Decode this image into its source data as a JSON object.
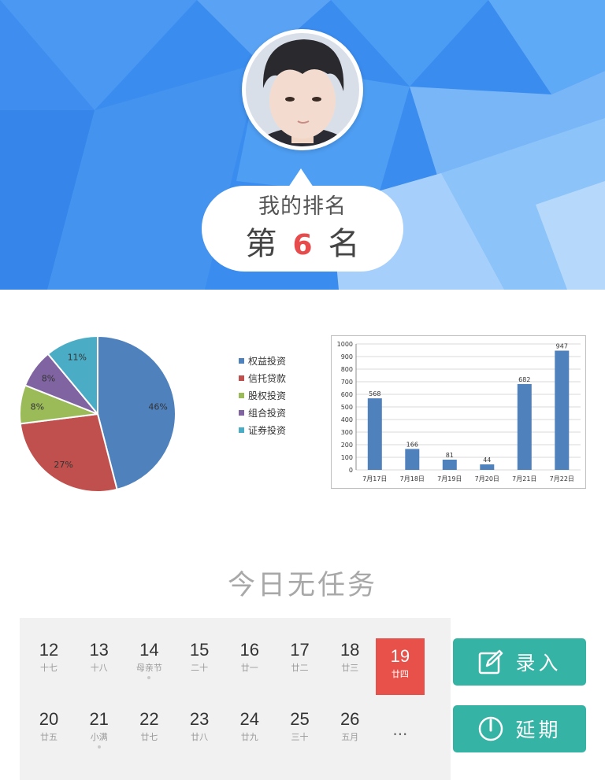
{
  "header": {
    "rank_title": "我的排名",
    "rank_prefix": "第",
    "rank_number": "6",
    "rank_suffix": "名"
  },
  "pie_legend": [
    {
      "label": "权益投资",
      "color": "#4f81bd"
    },
    {
      "label": "信托贷款",
      "color": "#c0504d"
    },
    {
      "label": "股权投资",
      "color": "#9bbb59"
    },
    {
      "label": "组合投资",
      "color": "#8064a2"
    },
    {
      "label": "证券投资",
      "color": "#4bacc6"
    }
  ],
  "chart_data": [
    {
      "type": "pie",
      "categories": [
        "权益投资",
        "信托贷款",
        "股权投资",
        "组合投资",
        "证券投资"
      ],
      "values": [
        46,
        27,
        8,
        8,
        11
      ],
      "labels": [
        "46%",
        "27%",
        "8%",
        "8%",
        "11%"
      ],
      "colors": [
        "#4f81bd",
        "#c0504d",
        "#9bbb59",
        "#8064a2",
        "#4bacc6"
      ]
    },
    {
      "type": "bar",
      "categories": [
        "7月17日",
        "7月18日",
        "7月19日",
        "7月20日",
        "7月21日",
        "7月22日"
      ],
      "values": [
        568,
        166,
        81,
        44,
        682,
        947
      ],
      "ylim": [
        0,
        1000
      ],
      "yticks": [
        0,
        100,
        200,
        300,
        400,
        500,
        600,
        700,
        800,
        900,
        1000
      ],
      "grid": true,
      "color": "#4f81bd"
    }
  ],
  "task": {
    "empty_text": "今日无任务"
  },
  "calendar": {
    "weeks": [
      [
        {
          "day": "12",
          "lunar": "十七"
        },
        {
          "day": "13",
          "lunar": "十八"
        },
        {
          "day": "14",
          "lunar": "母亲节",
          "dot": true
        },
        {
          "day": "15",
          "lunar": "二十"
        },
        {
          "day": "16",
          "lunar": "廿一"
        },
        {
          "day": "17",
          "lunar": "廿二"
        },
        {
          "day": "18",
          "lunar": "廿三"
        },
        {
          "day": "19",
          "lunar": "廿四",
          "today": true
        }
      ],
      [
        {
          "day": "20",
          "lunar": "廿五"
        },
        {
          "day": "21",
          "lunar": "小满",
          "dot": true
        },
        {
          "day": "22",
          "lunar": "廿七"
        },
        {
          "day": "23",
          "lunar": "廿八"
        },
        {
          "day": "24",
          "lunar": "廿九"
        },
        {
          "day": "25",
          "lunar": "三十"
        },
        {
          "day": "26",
          "lunar": "五月"
        }
      ]
    ],
    "more": "..."
  },
  "buttons": {
    "record": {
      "label": "录入",
      "icon": "edit-icon"
    },
    "delay": {
      "label": "延期",
      "icon": "timer-icon"
    }
  },
  "colors": {
    "header_blue": "#3d8ff0",
    "rank_red": "#e84b4b",
    "today_red": "#e8504a",
    "button_teal": "#35b3a4"
  }
}
